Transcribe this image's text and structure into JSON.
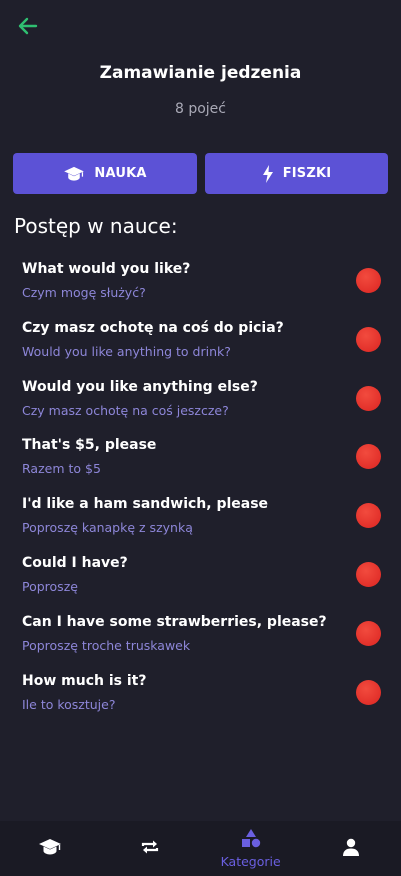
{
  "header": {
    "title": "Zamawianie jedzenia",
    "subtitle": "8 pojeć"
  },
  "actions": {
    "learn_label": "NAUKA",
    "cards_label": "FISZKI"
  },
  "progress_title": "Postęp w nauce:",
  "items": [
    {
      "question": "What would you like?",
      "answer": "Czym mogę służyć?"
    },
    {
      "question": "Czy masz ochotę na coś do picia?",
      "answer": "Would you like anything to drink?"
    },
    {
      "question": "Would you like anything else?",
      "answer": "Czy masz ochotę na coś jeszcze?"
    },
    {
      "question": "That's $5, please",
      "answer": "Razem to $5"
    },
    {
      "question": "I'd like a ham sandwich, please",
      "answer": "Poproszę kanapkę z szynką"
    },
    {
      "question": "Could I have?",
      "answer": "Poproszę"
    },
    {
      "question": "Can I have some strawberries, please?",
      "answer": "Poproszę troche truskawek"
    },
    {
      "question": "How much is it?",
      "answer": "Ile to kosztuje?"
    }
  ],
  "bottom_nav": {
    "active_label": "Kategorie"
  },
  "colors": {
    "background": "#1f1f2b",
    "accent": "#5c52d6",
    "back_arrow": "#2fbf71",
    "status_dot": "#e2302a"
  },
  "icons": [
    "back-arrow-icon",
    "graduation-cap-icon",
    "lightning-icon",
    "repeat-icon",
    "shapes-icon",
    "user-icon"
  ]
}
